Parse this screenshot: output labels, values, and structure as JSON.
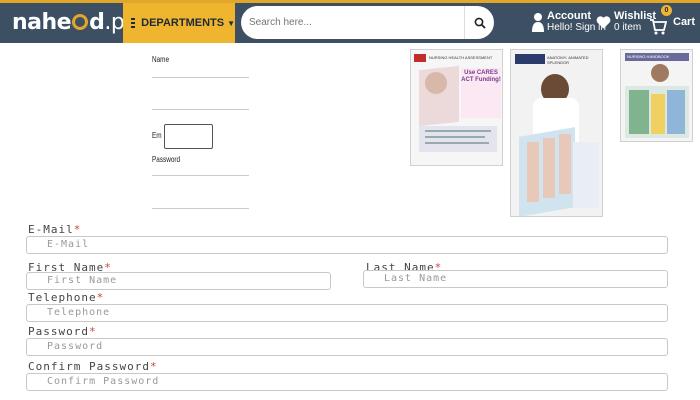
{
  "header": {
    "logo_text": "nahe",
    "logo_text2": "d",
    "logo_domain": ".pk",
    "departments_label": "DEPARTMENTS",
    "search_placeholder": "Search here...",
    "account_title": "Account",
    "account_sub": "Hello! Sign in",
    "wishlist_title": "Wishlist",
    "wishlist_sub": "0 item",
    "cart_label": "Cart",
    "cart_count": "0",
    "colors": {
      "bar": "#3d4f63",
      "accent": "#f0b52e"
    }
  },
  "small_form": {
    "name_label": "Name",
    "email_label": "Em",
    "password_label": "Password"
  },
  "products": [
    {
      "title": "NURSING HEALTH ASSESSMENT",
      "badge": "Use CARES ACT Funding!"
    },
    {
      "title": "ANATOMY: ANIMATED SPLENDOR",
      "badge": ""
    },
    {
      "title": "NURSING HANDBOOK",
      "badge": ""
    }
  ],
  "register": {
    "email_label": "E-Mail",
    "email_placeholder": "E-Mail",
    "first_name_label": "First Name",
    "first_name_placeholder": "First Name",
    "last_name_label": "Last Name",
    "last_name_placeholder": "Last Name",
    "telephone_label": "Telephone",
    "telephone_placeholder": "Telephone",
    "password_label": "Password",
    "password_placeholder": "Password",
    "confirm_label": "Confirm Password",
    "confirm_placeholder": "Confirm Password",
    "required_mark": "*"
  }
}
